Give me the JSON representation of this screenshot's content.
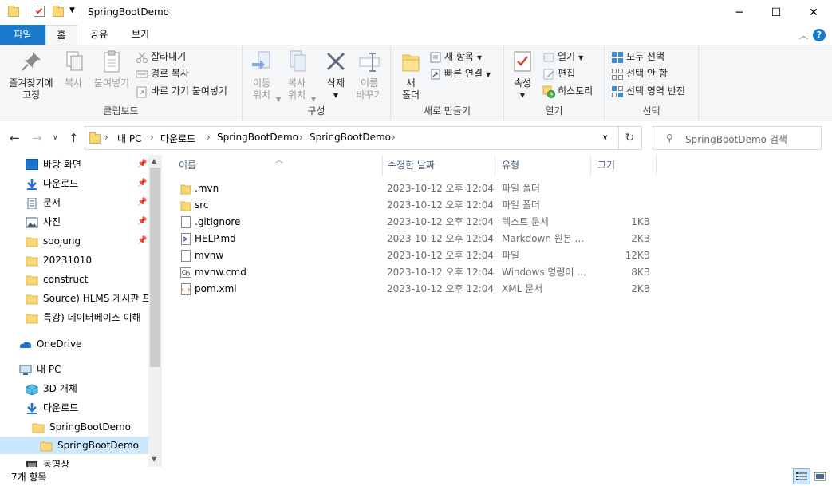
{
  "window": {
    "title": "SpringBootDemo",
    "minimize_glyph": "─",
    "maximize_glyph": "☐",
    "close_glyph": "✕"
  },
  "ribbon_tabs": [
    "파일",
    "홈",
    "공유",
    "보기"
  ],
  "ribbon": {
    "clipboard": {
      "pin_label_1": "즐겨찾기에",
      "pin_label_2": "고정",
      "copy": "복사",
      "paste": "붙여넣기",
      "cut": "잘라내기",
      "copy_path": "경로 복사",
      "paste_shortcut": "바로 가기 붙여넣기",
      "group": "클립보드"
    },
    "organize": {
      "move_to_1": "이동",
      "move_to_2": "위치",
      "copy_to_1": "복사",
      "copy_to_2": "위치",
      "delete": "삭제",
      "rename_1": "이름",
      "rename_2": "바꾸기",
      "group": "구성"
    },
    "new": {
      "new_folder_1": "새",
      "new_folder_2": "폴더",
      "new_item": "새 항목",
      "easy_access": "빠른 연결",
      "group": "새로 만들기"
    },
    "open": {
      "properties": "속성",
      "open": "열기",
      "edit": "편집",
      "history": "히스토리",
      "group": "열기"
    },
    "select": {
      "select_all": "모두 선택",
      "select_none": "선택 안 함",
      "invert": "선택 영역 반전",
      "group": "선택"
    }
  },
  "address": {
    "crumbs": [
      "내 PC",
      "다운로드",
      "SpringBootDemo",
      "SpringBootDemo"
    ],
    "search_placeholder": "SpringBootDemo 검색"
  },
  "nav": {
    "quick_access": [
      {
        "label": "바탕 화면",
        "pinned": true
      },
      {
        "label": "다운로드",
        "pinned": true
      },
      {
        "label": "문서",
        "pinned": true
      },
      {
        "label": "사진",
        "pinned": true
      },
      {
        "label": "soojung",
        "pinned": true
      },
      {
        "label": "20231010",
        "pinned": false
      },
      {
        "label": "construct",
        "pinned": false
      },
      {
        "label": "Source) HLMS 게시판 프",
        "pinned": false
      },
      {
        "label": "특강) 데이터베이스 이해",
        "pinned": false
      }
    ],
    "onedrive": "OneDrive",
    "this_pc": "내 PC",
    "objects_3d": "3D 개체",
    "downloads": "다운로드",
    "sbd_parent": "SpringBootDemo",
    "sbd_child": "SpringBootDemo",
    "videos": "동영상"
  },
  "columns": {
    "name": "이름",
    "modified": "수정한 날짜",
    "type": "유형",
    "size": "크기"
  },
  "files": [
    {
      "name": ".mvn",
      "modified": "2023-10-12 오후 12:04",
      "type": "파일 폴더",
      "size": "",
      "icon": "folder-icon"
    },
    {
      "name": "src",
      "modified": "2023-10-12 오후 12:04",
      "type": "파일 폴더",
      "size": "",
      "icon": "folder-icon"
    },
    {
      "name": ".gitignore",
      "modified": "2023-10-12 오후 12:04",
      "type": "텍스트 문서",
      "size": "1KB",
      "icon": "text-file-icon"
    },
    {
      "name": "HELP.md",
      "modified": "2023-10-12 오후 12:04",
      "type": "Markdown 원본 ...",
      "size": "2KB",
      "icon": "markdown-file-icon"
    },
    {
      "name": "mvnw",
      "modified": "2023-10-12 오후 12:04",
      "type": "파일",
      "size": "12KB",
      "icon": "file-icon"
    },
    {
      "name": "mvnw.cmd",
      "modified": "2023-10-12 오후 12:04",
      "type": "Windows 명령어 ...",
      "size": "8KB",
      "icon": "cmd-file-icon"
    },
    {
      "name": "pom.xml",
      "modified": "2023-10-12 오후 12:04",
      "type": "XML 문서",
      "size": "2KB",
      "icon": "xml-file-icon"
    }
  ],
  "status": {
    "item_count": "7개 항목"
  },
  "colors": {
    "accent": "#1979ca",
    "selection": "#cce8ff",
    "folder": "#f8d775"
  }
}
